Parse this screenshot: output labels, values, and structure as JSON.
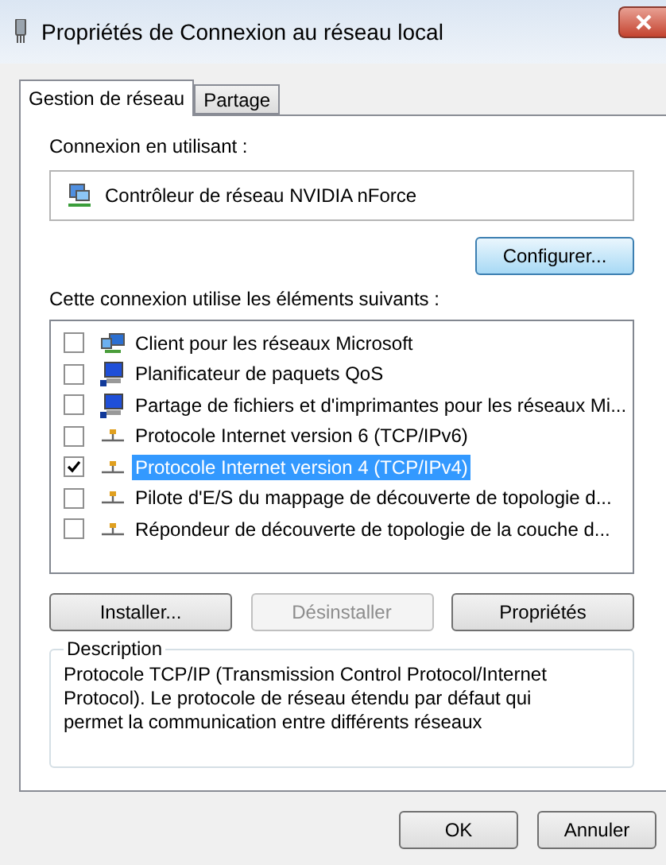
{
  "window": {
    "title": "Propriétés de Connexion au réseau local"
  },
  "tabs": [
    {
      "label": "Gestion de réseau",
      "selected": true
    },
    {
      "label": "Partage",
      "selected": false
    }
  ],
  "connection": {
    "label": "Connexion en utilisant :",
    "adapter": "Contrôleur de réseau NVIDIA nForce",
    "configure_button": "Configurer..."
  },
  "components": {
    "label": "Cette connexion utilise les éléments suivants :",
    "items": [
      {
        "kind": "client",
        "label": "Client pour les réseaux Microsoft",
        "checked": false,
        "selected": false
      },
      {
        "kind": "service",
        "label": "Planificateur de paquets QoS",
        "checked": false,
        "selected": false
      },
      {
        "kind": "service",
        "label": "Partage de fichiers et d'imprimantes pour les réseaux Mi...",
        "checked": false,
        "selected": false
      },
      {
        "kind": "protocol",
        "label": "Protocole Internet version 6 (TCP/IPv6)",
        "checked": false,
        "selected": false
      },
      {
        "kind": "protocol",
        "label": "Protocole Internet version 4 (TCP/IPv4)",
        "checked": true,
        "selected": true
      },
      {
        "kind": "protocol",
        "label": "Pilote d'E/S du mappage de découverte de topologie d...",
        "checked": false,
        "selected": false
      },
      {
        "kind": "protocol",
        "label": "Répondeur de découverte de topologie de la couche d...",
        "checked": false,
        "selected": false
      }
    ]
  },
  "actions": [
    {
      "label": "Installer...",
      "disabled": false
    },
    {
      "label": "Désinstaller",
      "disabled": true
    },
    {
      "label": "Propriétés",
      "disabled": false
    }
  ],
  "description": {
    "title": "Description",
    "text": "Protocole TCP/IP (Transmission Control Protocol/Internet Protocol). Le protocole de réseau étendu par défaut qui permet la communication entre différents réseaux"
  },
  "footer_buttons": [
    {
      "label": "OK"
    },
    {
      "label": "Annuler"
    }
  ]
}
